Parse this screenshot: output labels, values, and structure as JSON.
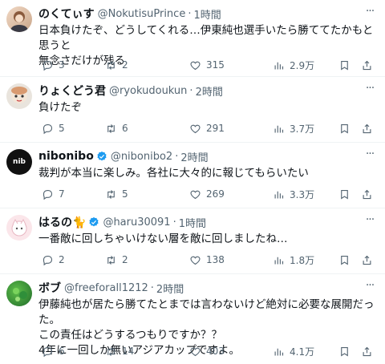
{
  "tweets": [
    {
      "name": "のくてぃす",
      "handle": "@NokutisuPrince",
      "time": "1時間",
      "text": "日本負けたぞ、どうしてくれる…伊東純也選手いたら勝ててたかもと思うと\n無念さだけが残る",
      "replies": "3",
      "retweets": "2",
      "likes": "315",
      "views": "2.9万",
      "verified": false
    },
    {
      "name": "りょくどう君",
      "handle": "@ryokudoukun",
      "time": "2時間",
      "text": "負けたぞ",
      "replies": "5",
      "retweets": "6",
      "likes": "291",
      "views": "3.7万",
      "verified": false
    },
    {
      "name": "nibonibo",
      "handle": "@nibonibo2",
      "time": "2時間",
      "text": "裁判が本当に楽しみ。各社に大々的に報じてもらいたい",
      "replies": "7",
      "retweets": "5",
      "likes": "269",
      "views": "3.3万",
      "verified": true,
      "avatar_text": "nib"
    },
    {
      "name": "はるの🐈",
      "handle": "@haru30091",
      "time": "1時間",
      "text": "一番敵に回しちゃいけない層を敵に回しましたね…",
      "replies": "2",
      "retweets": "2",
      "likes": "138",
      "views": "1.8万",
      "verified": true
    },
    {
      "name": "ボブ",
      "handle": "@freeforall1212",
      "time": "2時間",
      "text": "伊藤純也が居たら勝てたとまでは言わないけど絶対に必要な展開だった。\nこの責任はどうするつもりですか？？\n4年に一回しか無いアジアカップですよ。",
      "replies": "6",
      "retweets": "14",
      "likes": "403",
      "views": "4.1万",
      "verified": false
    }
  ],
  "colors": {
    "text": "#0f1419",
    "muted": "#536471",
    "verified": "#1d9bf0",
    "divider": "#eff3f4"
  },
  "icons": [
    "reply-icon",
    "retweet-icon",
    "like-icon",
    "views-icon",
    "bookmark-icon",
    "share-icon",
    "more-icon",
    "verified-badge-icon"
  ]
}
